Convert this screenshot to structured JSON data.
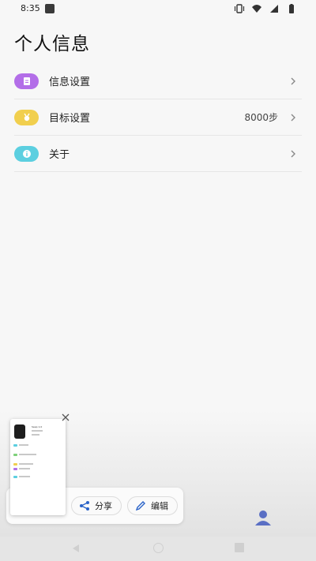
{
  "status_bar": {
    "time": "8:35"
  },
  "page": {
    "title": "个人信息"
  },
  "menu": [
    {
      "label": "信息设置",
      "value": "",
      "icon": "document-icon",
      "color": "#b36ee8"
    },
    {
      "label": "目标设置",
      "value": "8000步",
      "icon": "medal-icon",
      "color": "#f1cf4e"
    },
    {
      "label": "关于",
      "value": "",
      "icon": "info-icon",
      "color": "#5ccfe0"
    }
  ],
  "share_panel": {
    "share_label": "分享",
    "edit_label": "编辑"
  },
  "thumbnail": {
    "title": "Seep 1.0"
  },
  "colors": {
    "accent_blue": "#2a63c8",
    "profile": "#5a6fc4"
  }
}
